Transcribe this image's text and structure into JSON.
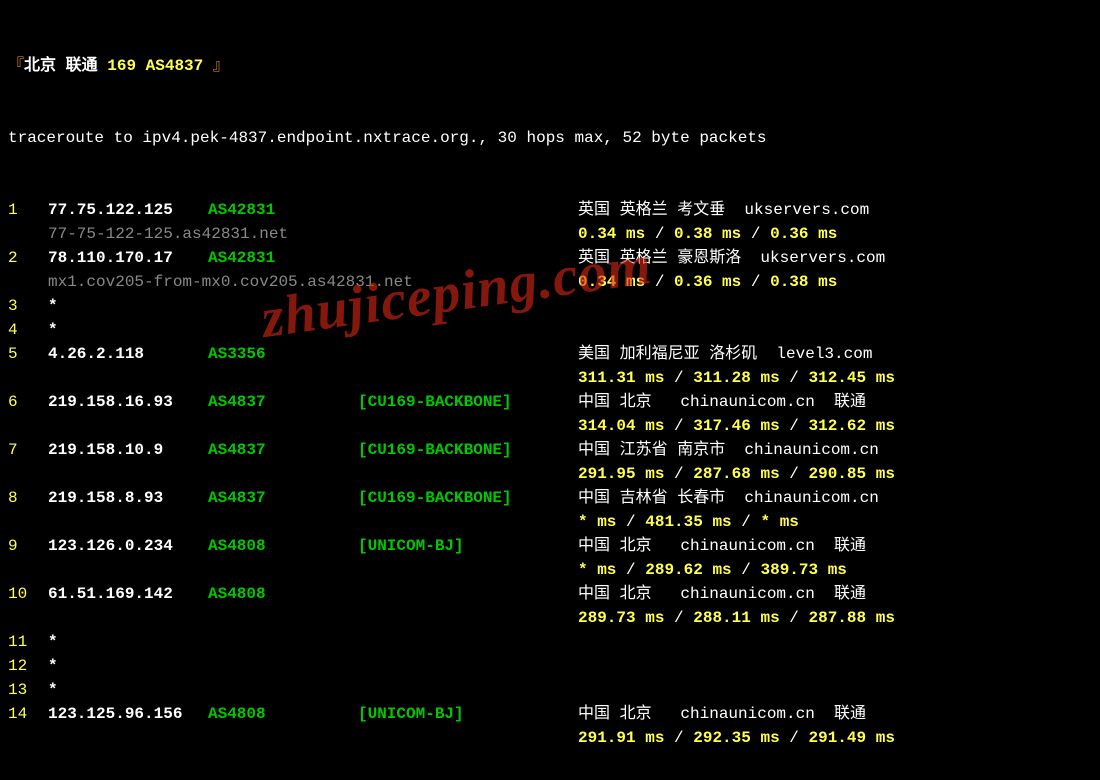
{
  "header": {
    "bracket_l": "『",
    "city": "北京 ",
    "isp": "联通 ",
    "as": "169 AS4837",
    "bracket_r": " 』"
  },
  "intro": "traceroute to ipv4.pek-4837.endpoint.nxtrace.org., 30 hops max, 52 byte packets",
  "watermark": "zhujiceping.com",
  "hops": [
    {
      "n": "1",
      "ip": "77.75.122.125",
      "asn": "AS42831",
      "net": "",
      "geo": "英国 英格兰 考文垂  ukservers.com",
      "rev": "77-75-122-125.as42831.net",
      "lat": [
        "0.34 ms",
        "0.38 ms",
        "0.36 ms"
      ]
    },
    {
      "n": "2",
      "ip": "78.110.170.17",
      "asn": "AS42831",
      "net": "",
      "geo": "英国 英格兰 豪恩斯洛  ukservers.com",
      "rev": "mx1.cov205-from-mx0.cov205.as42831.net",
      "lat": [
        "0.34 ms",
        "0.36 ms",
        "0.38 ms"
      ]
    },
    {
      "n": "3",
      "star": "*"
    },
    {
      "n": "4",
      "star": "*"
    },
    {
      "n": "5",
      "ip": "4.26.2.118",
      "asn": "AS3356",
      "net": "",
      "geo": "美国 加利福尼亚 洛杉矶  level3.com",
      "lat": [
        "311.31 ms",
        "311.28 ms",
        "312.45 ms"
      ]
    },
    {
      "n": "6",
      "ip": "219.158.16.93",
      "asn": "AS4837",
      "net": "[CU169-BACKBONE]",
      "geo": "中国 北京   chinaunicom.cn  联通",
      "lat": [
        "314.04 ms",
        "317.46 ms",
        "312.62 ms"
      ]
    },
    {
      "n": "7",
      "ip": "219.158.10.9",
      "asn": "AS4837",
      "net": "[CU169-BACKBONE]",
      "geo": "中国 江苏省 南京市  chinaunicom.cn",
      "lat": [
        "291.95 ms",
        "287.68 ms",
        "290.85 ms"
      ]
    },
    {
      "n": "8",
      "ip": "219.158.8.93",
      "asn": "AS4837",
      "net": "[CU169-BACKBONE]",
      "geo": "中国 吉林省 长春市  chinaunicom.cn",
      "lat": [
        "* ms",
        "481.35 ms",
        "* ms"
      ]
    },
    {
      "n": "9",
      "ip": "123.126.0.234",
      "asn": "AS4808",
      "net": "[UNICOM-BJ]",
      "geo": "中国 北京   chinaunicom.cn  联通",
      "lat": [
        "* ms",
        "289.62 ms",
        "389.73 ms"
      ]
    },
    {
      "n": "10",
      "ip": "61.51.169.142",
      "asn": "AS4808",
      "net": "",
      "geo": "中国 北京   chinaunicom.cn  联通",
      "lat": [
        "289.73 ms",
        "288.11 ms",
        "287.88 ms"
      ]
    },
    {
      "n": "11",
      "star": "*"
    },
    {
      "n": "12",
      "star": "*"
    },
    {
      "n": "13",
      "star": "*"
    },
    {
      "n": "14",
      "ip": "123.125.96.156",
      "asn": "AS4808",
      "net": "[UNICOM-BJ]",
      "geo": "中国 北京   chinaunicom.cn  联通",
      "lat": [
        "291.91 ms",
        "292.35 ms",
        "291.49 ms"
      ]
    }
  ]
}
